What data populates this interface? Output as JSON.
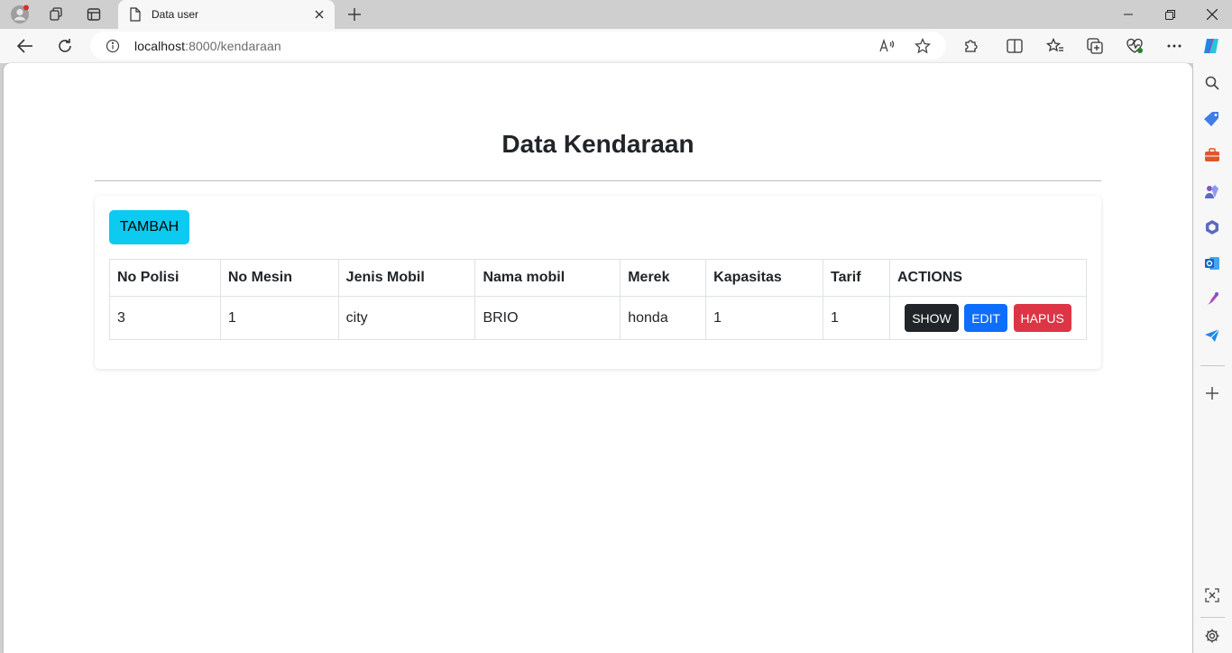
{
  "browser": {
    "tab_title": "Data user",
    "url_host": "localhost",
    "url_rest": ":8000/kendaraan"
  },
  "page": {
    "title": "Data Kendaraan",
    "add_button": "TAMBAH",
    "table": {
      "headers": [
        "No Polisi",
        "No Mesin",
        "Jenis Mobil",
        "Nama mobil",
        "Merek",
        "Kapasitas",
        "Tarif",
        "ACTIONS"
      ],
      "rows": [
        {
          "no_polisi": "3",
          "no_mesin": "1",
          "jenis_mobil": "city",
          "nama_mobil": "BRIO",
          "merek": "honda",
          "kapasitas": "1",
          "tarif": "1"
        }
      ],
      "actions": {
        "show": "SHOW",
        "edit": "EDIT",
        "delete": "HAPUS"
      }
    }
  },
  "colors": {
    "tambah": "#0dcaf0",
    "show": "#212529",
    "edit": "#0d6efd",
    "hapus": "#dc3545"
  }
}
